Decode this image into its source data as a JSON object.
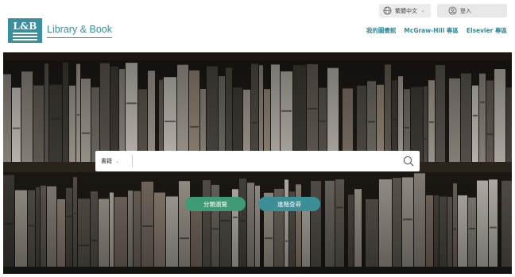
{
  "header": {
    "language": {
      "label": "繁體中文",
      "icon": "globe-icon"
    },
    "login": {
      "label": "登入",
      "icon": "user-circle-icon"
    },
    "logo": {
      "mark": "L&B",
      "name": "Library & Book"
    },
    "nav": [
      {
        "label": "我的圖書館"
      },
      {
        "label": "McGraw-Hill 專區"
      },
      {
        "label": "Elsevier 專區"
      }
    ]
  },
  "search": {
    "category": "書籍",
    "placeholder": "",
    "icon": "search-icon"
  },
  "actions": {
    "browse": "分類瀏覽",
    "advanced": "進階查尋"
  },
  "colors": {
    "brand": "#3a8f9e",
    "browse_button": "#3f9b75",
    "advanced_button": "#3c8e97"
  }
}
